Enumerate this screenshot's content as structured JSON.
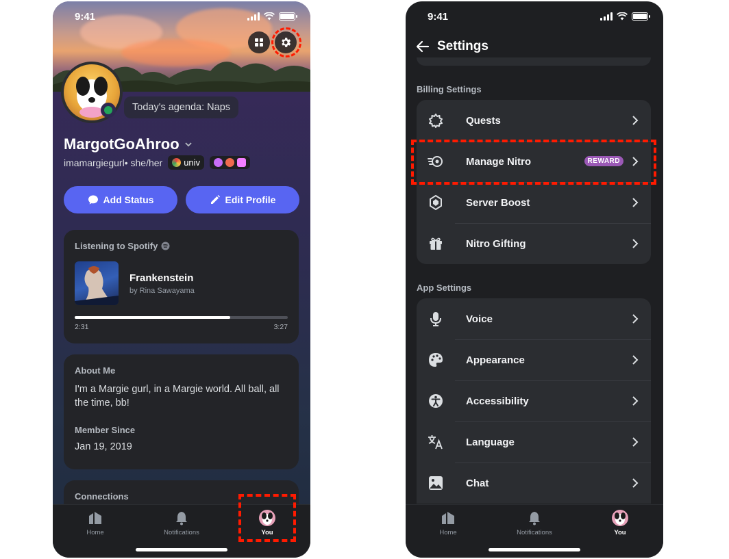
{
  "left_phone": {
    "status_time": "9:41",
    "status_text": "Today's agenda: Naps",
    "display_name": "MargotGoAhroo",
    "username": "imamargiegurl",
    "pronouns": "• she/her",
    "guild_tag": "univ",
    "add_status_label": "Add Status",
    "edit_profile_label": "Edit Profile",
    "spotify": {
      "header": "Listening to Spotify",
      "track": "Frankenstein",
      "artist": "by Rina Sawayama",
      "elapsed": "2:31",
      "duration": "3:27",
      "progress": 0.73
    },
    "about": {
      "label": "About Me",
      "text": "I'm a Margie gurl, in a Margie world. All ball, all the time, bb!",
      "member_label": "Member Since",
      "member_value": "Jan 19, 2019"
    },
    "connections_label": "Connections",
    "tabs": [
      "Home",
      "Notifications",
      "You"
    ]
  },
  "right_phone": {
    "status_time": "9:41",
    "title": "Settings",
    "billing_label": "Billing Settings",
    "billing_items": [
      "Quests",
      "Manage Nitro",
      "Server Boost",
      "Nitro Gifting"
    ],
    "reward_badge": "REWARD",
    "app_label": "App Settings",
    "app_items": [
      "Voice",
      "Appearance",
      "Accessibility",
      "Language",
      "Chat"
    ],
    "tabs": [
      "Home",
      "Notifications",
      "You"
    ]
  },
  "colors": {
    "blurple": "#5865f2",
    "highlight_red": "#ff1a00",
    "online_green": "#23a55a",
    "reward_purple": "#9b59b6"
  }
}
